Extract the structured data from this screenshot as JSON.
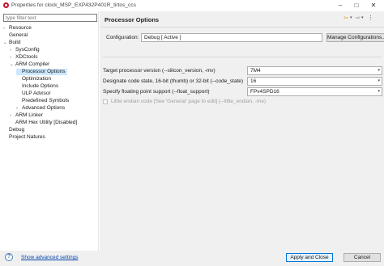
{
  "window": {
    "title": "Properties for clock_MSP_EXP432P401R_tirtos_ccs",
    "minimize": "–",
    "maximize": "□",
    "close": "✕"
  },
  "filter": {
    "placeholder": "type filter text"
  },
  "tree": [
    {
      "label": "Resource",
      "arrow": "›",
      "indent": 0
    },
    {
      "label": "General",
      "arrow": "",
      "indent": 0
    },
    {
      "label": "Build",
      "arrow": "⌄",
      "indent": 0
    },
    {
      "label": "SysConfig",
      "arrow": "›",
      "indent": 1
    },
    {
      "label": "XDCtools",
      "arrow": "›",
      "indent": 1
    },
    {
      "label": "ARM Compiler",
      "arrow": "⌄",
      "indent": 1
    },
    {
      "label": "Processor Options",
      "arrow": "",
      "indent": 2,
      "selected": true
    },
    {
      "label": "Optimization",
      "arrow": "",
      "indent": 2
    },
    {
      "label": "Include Options",
      "arrow": "",
      "indent": 2
    },
    {
      "label": "ULP Advisor",
      "arrow": "",
      "indent": 2
    },
    {
      "label": "Predefined Symbols",
      "arrow": "",
      "indent": 2
    },
    {
      "label": "Advanced Options",
      "arrow": "›",
      "indent": 2
    },
    {
      "label": "ARM Linker",
      "arrow": "›",
      "indent": 1
    },
    {
      "label": "ARM Hex Utility  [Disabled]",
      "arrow": "",
      "indent": 1
    },
    {
      "label": "Debug",
      "arrow": "",
      "indent": 0
    },
    {
      "label": "Project Natures",
      "arrow": "",
      "indent": 0
    }
  ],
  "header": {
    "title": "Processor Options",
    "back_icon": "⇦",
    "dropdown_icon": "▾",
    "forward_icon": "⇨",
    "menu_icon": "⋮"
  },
  "configuration": {
    "label": "Configuration:",
    "value": "Debug  [ Active ]",
    "manage_label": "Manage Configurations..."
  },
  "options": [
    {
      "label": "Target processor version (--silicon_version, -mv)",
      "value": "7M4"
    },
    {
      "label": "Designate code state, 16-bit (thumb) or 32-bit (--code_state)",
      "value": "16"
    },
    {
      "label": "Specify floating point support (--float_support)",
      "value": "FPv4SPD16"
    }
  ],
  "little_endian": {
    "label": "Little endian code [See 'General' page to edit] (--little_endian, -me)",
    "checked": false,
    "enabled": false
  },
  "footer": {
    "help_icon": "?",
    "advanced_link": "Show advanced settings",
    "apply_close": "Apply and Close",
    "cancel": "Cancel"
  },
  "colors": {
    "selection": "#cce8ff",
    "link": "#0645ad",
    "default_button_border": "#0078d7",
    "panel_bg": "#f0f0f0",
    "back_arrow": "#e0901a"
  }
}
